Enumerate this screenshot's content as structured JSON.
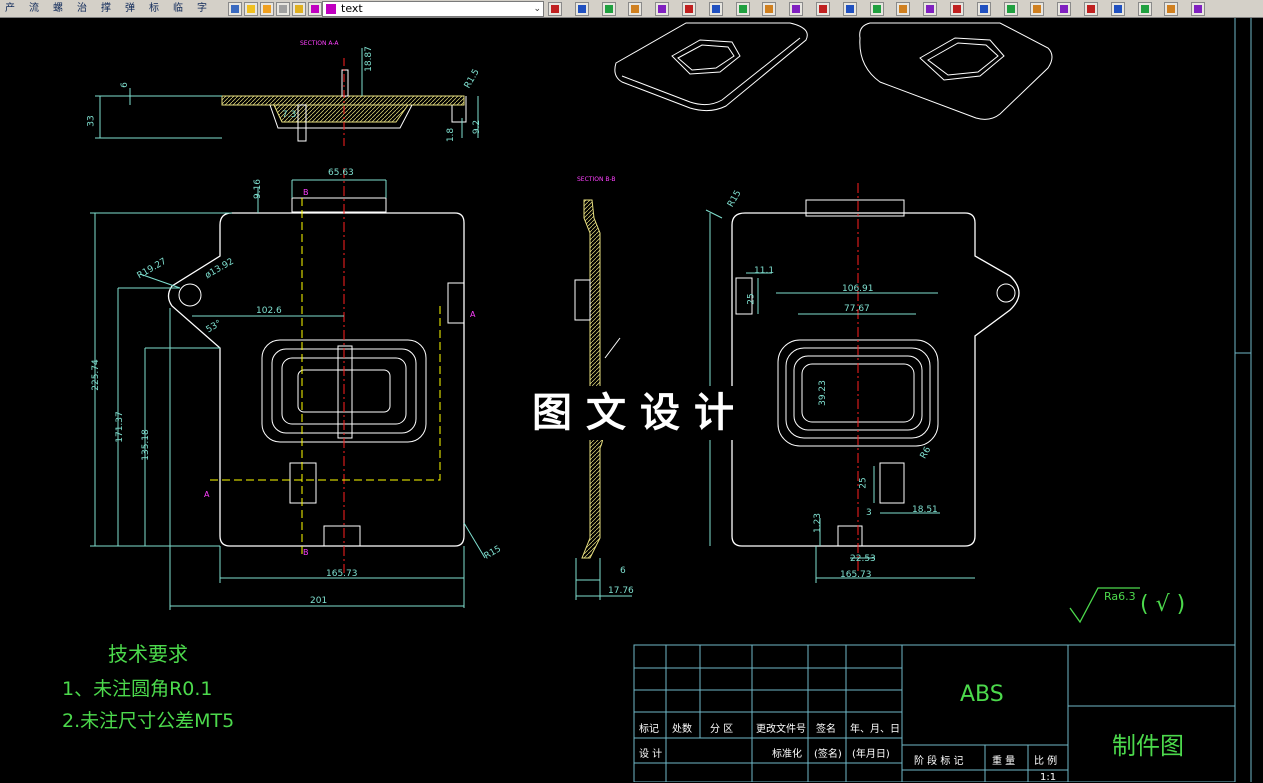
{
  "toolbar": {
    "left_buttons": [
      "产",
      "流",
      "螺",
      "治",
      "撑",
      "弹",
      "标",
      "临",
      "字"
    ],
    "layer_name": "text",
    "layer_color": "#c000c0",
    "icons": [
      "hatch-icon",
      "light-bulb-icon",
      "sun-icon",
      "layer-freeze-icon",
      "lock-icon",
      "layer-color-icon"
    ],
    "right_icons": [
      "snap-icon",
      "line-icon",
      "polyline-icon",
      "arc-icon",
      "circle-icon",
      "spline-icon",
      "rectangle-icon",
      "dimension-icon",
      "angle-icon",
      "measure-icon",
      "offset-icon",
      "trim-icon",
      "extend-icon",
      "fillet-icon",
      "chamfer-icon",
      "mirror-icon",
      "move-icon",
      "copy-icon",
      "rotate-icon",
      "scale-icon",
      "stretch-icon",
      "array-icon",
      "explode-icon",
      "table-icon",
      "search-icon"
    ]
  },
  "drawing": {
    "section_aa": "SECTION A-A",
    "section_bb": "SECTION B-B",
    "dimensions_top": [
      "6",
      "33",
      "18.87",
      "R1.5",
      "7.3",
      "1.8",
      "9.2"
    ],
    "dimensions_front": [
      "65.63",
      "9.16",
      "R19.27",
      "ø13.92",
      "102.6",
      "53°",
      "225.74",
      "171.37",
      "135.18",
      "165.73",
      "201",
      "R15"
    ],
    "section_labels": [
      "B",
      "B",
      "A",
      "A"
    ],
    "dimensions_side": [
      "6",
      "17.76"
    ],
    "dimensions_rear": [
      "R15",
      "11.1",
      "25",
      "106.91",
      "77.67",
      "39.23",
      "R6",
      "25",
      "3",
      "18.51",
      "1.23",
      "22.53",
      "165.73"
    ],
    "watermark": "图文设计",
    "roughness_label": "Ra6.3",
    "roughness_check": "(  √  )"
  },
  "tech_requirements": {
    "title": "技术要求",
    "lines": [
      "1、未注圆角R0.1",
      "2.未注尺寸公差MT5"
    ]
  },
  "title_block": {
    "material": "ABS",
    "drawing_name": "制件图",
    "row_labels": [
      "标记",
      "处数",
      "分 区",
      "更改文件号",
      "签名",
      "年、月、日"
    ],
    "row2_labels": [
      "设 计",
      "标准化",
      "(签名)",
      "(年月日)"
    ],
    "stage_labels": [
      "阶 段 标 记",
      "重 量",
      "比 例"
    ],
    "scale": "1:1"
  },
  "colors": {
    "cad_background": "#000000",
    "outline": "#ffffff",
    "dimension": "#7fe0d0",
    "centerline": "#ff2020",
    "hatch": "#e8e080",
    "tech_text": "#4cd94c",
    "section_text": "#ff40ff",
    "frame": "#6fb8c8"
  }
}
